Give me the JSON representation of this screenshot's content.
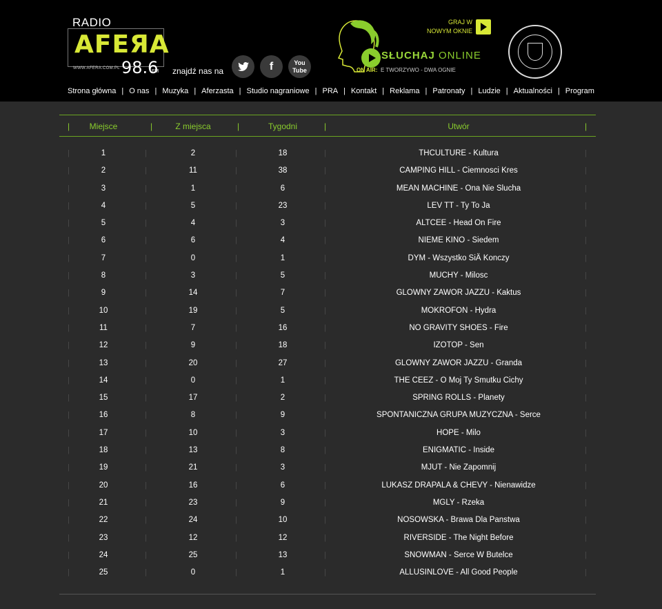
{
  "header": {
    "logo": {
      "radio": "RADIO",
      "mark": "AFEЯA",
      "freq": "98.6",
      "freq_unit": "FM",
      "url": "WWW.AFERA.COM.PL"
    },
    "find_us": "znajdź nas na",
    "social": [
      {
        "name": "twitter-icon",
        "glyph": "🐦"
      },
      {
        "name": "facebook-icon",
        "glyph": "f"
      },
      {
        "name": "youtube-icon",
        "glyph": "You Tube"
      }
    ],
    "listen": {
      "title_a": "SŁUCHAJ",
      "title_b": "ONLINE",
      "on_air": "ON AIR:",
      "now_playing": "E TWORZYWO - DWA OGNIE"
    },
    "new_window": {
      "line1": "GRAJ W",
      "line2": "NOWYM OKNIE"
    }
  },
  "nav": [
    "Strona główna",
    "O nas",
    "Muzyka",
    "Aferzasta",
    "Studio nagraniowe",
    "PRA",
    "Kontakt",
    "Reklama",
    "Patronaty",
    "Ludzie",
    "Aktualności",
    "Program"
  ],
  "chart": {
    "headers": {
      "place": "Miejsce",
      "from_place": "Z miejsca",
      "weeks": "Tygodni",
      "track": "Utwór"
    },
    "rows": [
      {
        "place": "1",
        "from": "2",
        "weeks": "18",
        "track": "THCULTURE - Kultura"
      },
      {
        "place": "2",
        "from": "11",
        "weeks": "38",
        "track": "CAMPING HILL - Ciemnosci Kres"
      },
      {
        "place": "3",
        "from": "1",
        "weeks": "6",
        "track": "MEAN MACHINE - Ona Nie Slucha"
      },
      {
        "place": "4",
        "from": "5",
        "weeks": "23",
        "track": "LEV TT - Ty To Ja"
      },
      {
        "place": "5",
        "from": "4",
        "weeks": "3",
        "track": "ALTCEE - Head On Fire"
      },
      {
        "place": "6",
        "from": "6",
        "weeks": "4",
        "track": "NIEME KINO - Siedem"
      },
      {
        "place": "7",
        "from": "0",
        "weeks": "1",
        "track": "DYM - Wszystko SiÄ Konczy"
      },
      {
        "place": "8",
        "from": "3",
        "weeks": "5",
        "track": "MUCHY - Milosc"
      },
      {
        "place": "9",
        "from": "14",
        "weeks": "7",
        "track": "GLOWNY ZAWOR JAZZU - Kaktus"
      },
      {
        "place": "10",
        "from": "19",
        "weeks": "5",
        "track": "MOKROFON - Hydra"
      },
      {
        "place": "11",
        "from": "7",
        "weeks": "16",
        "track": "NO GRAVITY SHOES - Fire"
      },
      {
        "place": "12",
        "from": "9",
        "weeks": "18",
        "track": "IZOTOP - Sen"
      },
      {
        "place": "13",
        "from": "20",
        "weeks": "27",
        "track": "GLOWNY ZAWOR JAZZU - Granda"
      },
      {
        "place": "14",
        "from": "0",
        "weeks": "1",
        "track": "THE CEEZ - O Moj Ty Smutku Cichy"
      },
      {
        "place": "15",
        "from": "17",
        "weeks": "2",
        "track": "SPRING ROLLS - Planety"
      },
      {
        "place": "16",
        "from": "8",
        "weeks": "9",
        "track": "SPONTANICZNA GRUPA MUZYCZNA - Serce"
      },
      {
        "place": "17",
        "from": "10",
        "weeks": "3",
        "track": "HOPE - Milo"
      },
      {
        "place": "18",
        "from": "13",
        "weeks": "8",
        "track": "ENIGMATIC - Inside"
      },
      {
        "place": "19",
        "from": "21",
        "weeks": "3",
        "track": "MJUT - Nie Zapomnij"
      },
      {
        "place": "20",
        "from": "16",
        "weeks": "6",
        "track": "LUKASZ DRAPALA & CHEVY - Nienawidze"
      },
      {
        "place": "21",
        "from": "23",
        "weeks": "9",
        "track": "MGLY - Rzeka"
      },
      {
        "place": "22",
        "from": "24",
        "weeks": "10",
        "track": "NOSOWSKA - Brawa Dla Panstwa"
      },
      {
        "place": "23",
        "from": "12",
        "weeks": "12",
        "track": "RIVERSIDE - The Night Before"
      },
      {
        "place": "24",
        "from": "25",
        "weeks": "13",
        "track": "SNOWMAN - Serce W Butelce"
      },
      {
        "place": "25",
        "from": "0",
        "weeks": "1",
        "track": "ALLUSINLOVE - All Good People"
      }
    ]
  },
  "colors": {
    "accent": "#8acd2d",
    "logo_yellow": "#d8e836",
    "background": "#2b2b2b",
    "header_bg": "#000000"
  }
}
